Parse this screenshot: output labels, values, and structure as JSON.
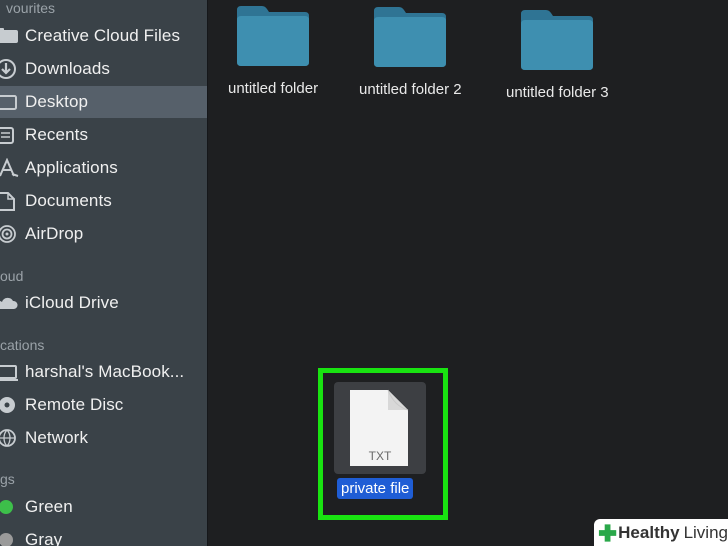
{
  "sidebar": {
    "sections": {
      "favourites": "vourites",
      "icloud": "oud",
      "locations": "cations",
      "tags": "gs"
    },
    "items": [
      {
        "label": "Creative Cloud Files",
        "icon": "creative-cloud-icon"
      },
      {
        "label": "Downloads",
        "icon": "downloads-icon"
      },
      {
        "label": "Desktop",
        "icon": "desktop-icon",
        "selected": true
      },
      {
        "label": "Recents",
        "icon": "recents-icon"
      },
      {
        "label": "Applications",
        "icon": "applications-icon"
      },
      {
        "label": "Documents",
        "icon": "documents-icon"
      },
      {
        "label": "AirDrop",
        "icon": "airdrop-icon"
      },
      {
        "label": "iCloud Drive",
        "icon": "cloud-icon"
      },
      {
        "label": "harshal's MacBook...",
        "icon": "laptop-icon"
      },
      {
        "label": "Remote Disc",
        "icon": "disc-icon"
      },
      {
        "label": "Network",
        "icon": "network-icon"
      },
      {
        "label": "Green",
        "icon": "tag-dot-icon",
        "color": "#3dbf4a"
      },
      {
        "label": "Gray",
        "icon": "tag-dot-icon",
        "color": "#9a9a9a"
      }
    ]
  },
  "main": {
    "folders": [
      {
        "label": "untitled folder"
      },
      {
        "label": "untitled folder 2"
      },
      {
        "label": "untitled folder 3"
      }
    ],
    "file": {
      "name": "private file",
      "type_label": "TXT"
    }
  },
  "colors": {
    "folder": "#3e8fb0",
    "selection": "#1f5dd5",
    "highlight": "#19e311"
  },
  "watermark": {
    "part1": "Healthy",
    "part2": "Living"
  }
}
